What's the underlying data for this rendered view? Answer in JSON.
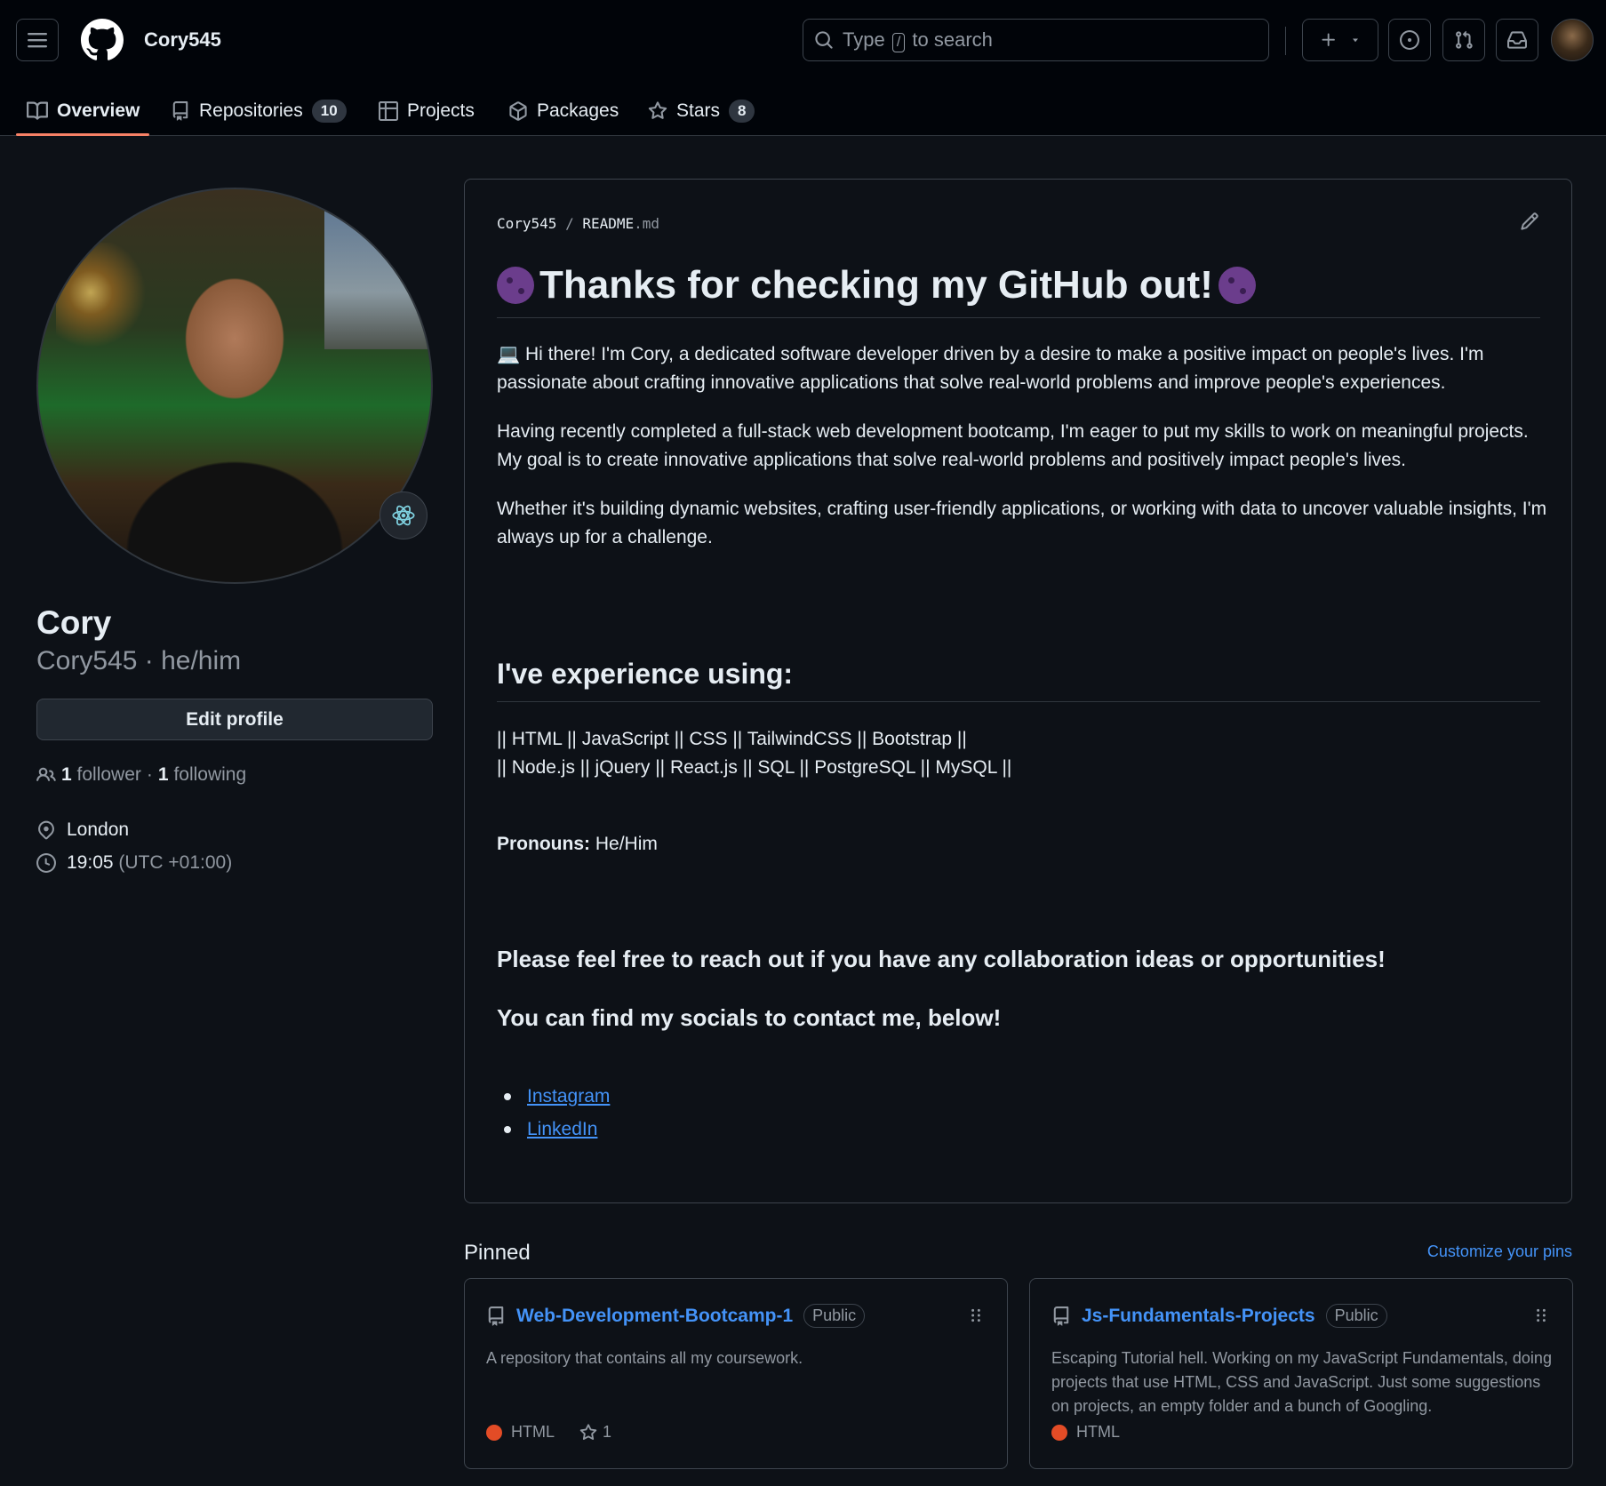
{
  "header": {
    "username": "Cory545",
    "search": {
      "before": "Type",
      "key": "/",
      "after": "to search"
    }
  },
  "tabs": [
    {
      "label": "Overview"
    },
    {
      "label": "Repositories",
      "count": "10"
    },
    {
      "label": "Projects"
    },
    {
      "label": "Packages"
    },
    {
      "label": "Stars",
      "count": "8"
    }
  ],
  "profile": {
    "name": "Cory",
    "login": "Cory545",
    "separator": "·",
    "pronouns": "he/him",
    "edit_label": "Edit profile",
    "followers_count": "1",
    "followers_label": "follower",
    "following_count": "1",
    "following_label": "following",
    "location": "London",
    "time": "19:05",
    "timezone": "(UTC +01:00)"
  },
  "readme": {
    "owner": "Cory545",
    "slash": "/",
    "file": "README",
    "ext": ".md",
    "title": "Thanks for checking my GitHub out!",
    "para1_emoji": "💻",
    "para1": "Hi there! I'm Cory, a dedicated software developer driven by a desire to make a positive impact on people's lives. I'm passionate about crafting innovative applications that solve real-world problems and improve people's experiences.",
    "para2": "Having recently completed a full-stack web development bootcamp, I'm eager to put my skills to work on meaningful projects. My goal is to create innovative applications that solve real-world problems and positively impact people's lives.",
    "para3": "Whether it's building dynamic websites, crafting user-friendly applications, or working with data to uncover valuable insights, I'm always up for a challenge.",
    "experience_heading": "I've experience using:",
    "skills_line1": "|| HTML || JavaScript || CSS || TailwindCSS || Bootstrap ||",
    "skills_line2": "|| Node.js || jQuery || React.js || SQL || PostgreSQL || MySQL ||",
    "pronouns_label": "Pronouns:",
    "pronouns_value": "He/Him",
    "cta1": "Please feel free to reach out if you have any collaboration ideas or opportunities!",
    "cta2": "You can find my socials to contact me, below!",
    "links": [
      "Instagram",
      "LinkedIn"
    ]
  },
  "pinned": {
    "title": "Pinned",
    "customize": "Customize your pins",
    "repos": [
      {
        "name": "Web-Development-Bootcamp-1",
        "visibility": "Public",
        "description": "A repository that contains all my coursework.",
        "language": "HTML",
        "language_color": "#e34c26",
        "stars": "1"
      },
      {
        "name": "Js-Fundamentals-Projects",
        "visibility": "Public",
        "description": "Escaping Tutorial hell. Working on my JavaScript Fundamentals, doing projects that use HTML, CSS and JavaScript. Just some suggestions on projects, an empty folder and a bunch of Googling.",
        "language": "HTML",
        "language_color": "#e34c26"
      }
    ]
  },
  "colors": {
    "background": "#0d1117",
    "header": "#010409",
    "accent": "#f78166",
    "link": "#4493f8"
  }
}
